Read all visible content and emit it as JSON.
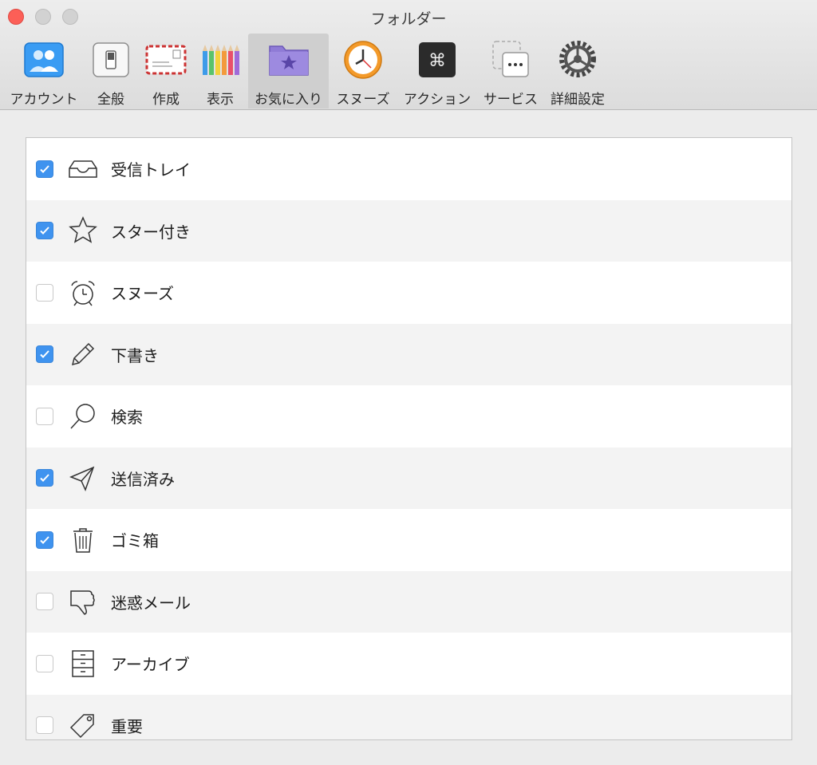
{
  "window": {
    "title": "フォルダー"
  },
  "toolbar": {
    "items": [
      {
        "label": "アカウント",
        "icon": "accounts-icon"
      },
      {
        "label": "全般",
        "icon": "general-switch-icon"
      },
      {
        "label": "作成",
        "icon": "compose-envelope-icon"
      },
      {
        "label": "表示",
        "icon": "colored-pencils-icon"
      },
      {
        "label": "お気に入り",
        "icon": "star-folder-icon",
        "selected": true
      },
      {
        "label": "スヌーズ",
        "icon": "clock-icon"
      },
      {
        "label": "アクション",
        "icon": "command-key-icon"
      },
      {
        "label": "サービス",
        "icon": "services-dots-icon"
      },
      {
        "label": "詳細設定",
        "icon": "gear-icon"
      }
    ]
  },
  "folders": [
    {
      "label": "受信トレイ",
      "checked": true,
      "icon": "inbox-tray-icon"
    },
    {
      "label": "スター付き",
      "checked": true,
      "icon": "star-icon"
    },
    {
      "label": "スヌーズ",
      "checked": false,
      "icon": "alarm-clock-icon"
    },
    {
      "label": "下書き",
      "checked": true,
      "icon": "pencil-icon"
    },
    {
      "label": "検索",
      "checked": false,
      "icon": "search-icon"
    },
    {
      "label": "送信済み",
      "checked": true,
      "icon": "paper-plane-icon"
    },
    {
      "label": "ゴミ箱",
      "checked": true,
      "icon": "trash-icon"
    },
    {
      "label": "迷惑メール",
      "checked": false,
      "icon": "thumbs-down-icon"
    },
    {
      "label": "アーカイブ",
      "checked": false,
      "icon": "archive-drawers-icon"
    },
    {
      "label": "重要",
      "checked": false,
      "icon": "tag-icon"
    }
  ],
  "colors": {
    "checkbox_accent": "#3f93ef",
    "close_button": "#fc5f57"
  }
}
